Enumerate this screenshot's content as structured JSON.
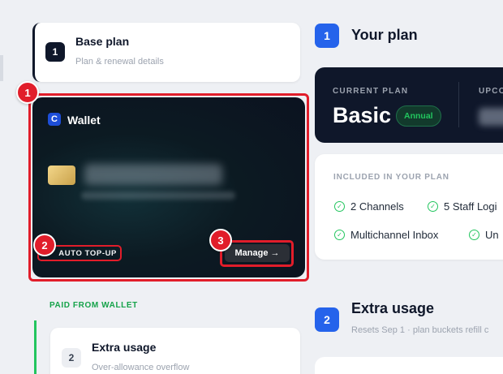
{
  "left": {
    "base_plan": {
      "step": "1",
      "title": "Base plan",
      "subtitle": "Plan & renewal details"
    },
    "wallet": {
      "logo_letter": "C",
      "title": "Wallet",
      "auto_topup_label": "AUTO TOP-UP",
      "manage_label": "Manage →"
    },
    "paid_from_wallet_label": "PAID FROM WALLET",
    "extra_usage": {
      "step": "2",
      "title": "Extra usage",
      "subtitle": "Over-allowance overflow"
    }
  },
  "annotations": [
    "1",
    "2",
    "3"
  ],
  "right": {
    "your_plan": {
      "step": "1",
      "title": "Your plan"
    },
    "current_plan": {
      "label": "CURRENT PLAN",
      "name": "Basic",
      "billing_badge": "Annual",
      "upcoming_label_partial": "UPCO"
    },
    "included": {
      "label": "INCLUDED IN YOUR PLAN",
      "features": [
        "2 Channels",
        "5 Staff Logi",
        "Multichannel Inbox",
        "Un"
      ]
    },
    "extra_usage": {
      "step": "2",
      "title": "Extra usage",
      "resets": "Resets Sep 1 · plan buckets refill c"
    }
  },
  "colors": {
    "accent_blue": "#2563eb",
    "annotation_red": "#e11d2a",
    "success_green": "#22c55e",
    "dark_navy": "#0f172a"
  }
}
